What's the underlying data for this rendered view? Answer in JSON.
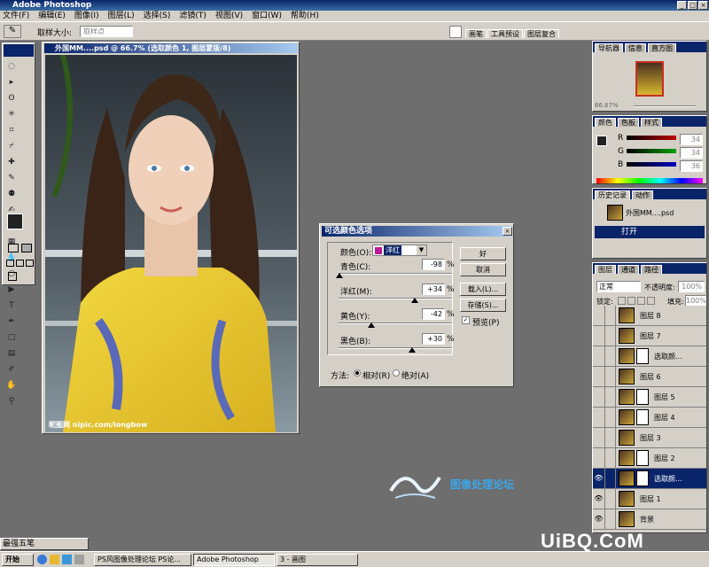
{
  "app": {
    "title": "Adobe Photoshop"
  },
  "menu": [
    "文件(F)",
    "编辑(E)",
    "图像(I)",
    "图层(L)",
    "选择(S)",
    "滤镜(T)",
    "视图(V)",
    "窗口(W)",
    "帮助(H)"
  ],
  "options": {
    "sample_size_label": "取样大小:",
    "sample_size_value": "取样点"
  },
  "palette_well": [
    "画笔",
    "工具预设",
    "图层复合"
  ],
  "document": {
    "title": "外国MM....psd @ 66.7% (选取颜色 1, 图层蒙版/8)",
    "watermark": "昵图网 nipic.com/longbow"
  },
  "dialog": {
    "title": "可选颜色选项",
    "colors_label": "颜色(O):",
    "colors_value": "洋红",
    "sliders": [
      {
        "label": "青色(C):",
        "value": "-98",
        "unit": "%",
        "level": -98
      },
      {
        "label": "洋红(M):",
        "value": "+34",
        "unit": "%",
        "level": 34
      },
      {
        "label": "黄色(Y):",
        "value": "-42",
        "unit": "%",
        "level": -42
      },
      {
        "label": "黑色(B):",
        "value": "+30",
        "unit": "%",
        "level": 30
      }
    ],
    "buttons": {
      "ok": "好",
      "cancel": "取消",
      "load": "载入(L)...",
      "save": "存储(S)...",
      "preview": "预览(P)"
    },
    "method_label": "方法:",
    "method_relative": "相对(R)",
    "method_absolute": "绝对(A)"
  },
  "navigator": {
    "tabs": [
      "导航器",
      "信息",
      "直方图"
    ],
    "zoom": "66.67%"
  },
  "color_panel": {
    "tabs": [
      "颜色",
      "色板",
      "样式"
    ],
    "channels": [
      {
        "label": "R",
        "value": "34"
      },
      {
        "label": "G",
        "value": "34"
      },
      {
        "label": "B",
        "value": "36"
      }
    ]
  },
  "history": {
    "tabs": [
      "历史记录",
      "动作"
    ],
    "snapshot": "外国MM....psd",
    "items": [
      "打开"
    ]
  },
  "layers": {
    "tabs": [
      "图层",
      "通道",
      "路径"
    ],
    "blend_mode": "正常",
    "opacity_label": "不透明度:",
    "opacity_value": "100%",
    "lock_label": "锁定:",
    "fill_label": "填充:",
    "fill_value": "100%",
    "rows": [
      {
        "name": "图层 8",
        "eye": "",
        "mask": false,
        "selected": false
      },
      {
        "name": "图层 7",
        "eye": "",
        "mask": false,
        "selected": false
      },
      {
        "name": "选取颜...",
        "eye": "",
        "mask": true,
        "selected": false
      },
      {
        "name": "图层 6",
        "eye": "",
        "mask": false,
        "selected": false
      },
      {
        "name": "图层 5",
        "eye": "",
        "mask": true,
        "selected": false
      },
      {
        "name": "图层 4",
        "eye": "",
        "mask": true,
        "selected": false
      },
      {
        "name": "图层 3",
        "eye": "",
        "mask": false,
        "selected": false
      },
      {
        "name": "图层 2",
        "eye": "",
        "mask": true,
        "selected": false
      },
      {
        "name": "选取颜...",
        "eye": "👁",
        "mask": true,
        "selected": true
      },
      {
        "name": "图层 1",
        "eye": "👁",
        "mask": false,
        "selected": false
      },
      {
        "name": "背景",
        "eye": "👁",
        "mask": false,
        "selected": false
      }
    ]
  },
  "logo": {
    "brand": "图像处理论坛"
  },
  "taskbar": {
    "ime": "最强五笔",
    "start": "开始",
    "items": [
      "PS风图像处理论坛 PS论...",
      "Adobe Photoshop",
      "3 - 画图"
    ]
  },
  "corner_logo": "UiBQ.CoM"
}
